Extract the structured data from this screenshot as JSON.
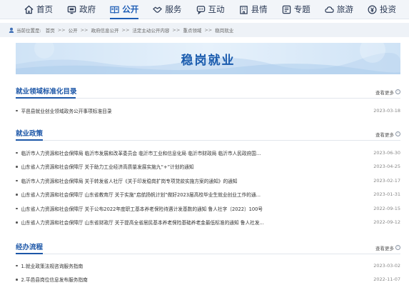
{
  "nav": {
    "items": [
      {
        "label": "首页",
        "icon": "home-icon",
        "active": false
      },
      {
        "label": "政府",
        "icon": "government-icon",
        "active": false
      },
      {
        "label": "公开",
        "icon": "book-icon",
        "active": true
      },
      {
        "label": "服务",
        "icon": "handshake-icon",
        "active": false
      },
      {
        "label": "互动",
        "icon": "chat-icon",
        "active": false
      },
      {
        "label": "县情",
        "icon": "building-icon",
        "active": false
      },
      {
        "label": "专题",
        "icon": "topic-icon",
        "active": false
      },
      {
        "label": "旅游",
        "icon": "cloud-icon",
        "active": false
      },
      {
        "label": "投资",
        "icon": "yuan-icon",
        "active": false
      }
    ],
    "accent_color": "#1c5cb5"
  },
  "breadcrumb": {
    "prefix": "当前位置是:",
    "separator": ">>",
    "items": [
      "首页",
      "公开",
      "政府信息公开",
      "法定主动公开内容",
      "重点领域",
      "稳岗就业"
    ]
  },
  "banner": {
    "title": "稳岗就业"
  },
  "sections": [
    {
      "title": "就业领域标准化目录",
      "more_label": "查看更多",
      "items": [
        {
          "text": "平邑县就业创业领域政务公开事项标准目录",
          "date": "2023-03-18"
        }
      ]
    },
    {
      "title": "就业政策",
      "more_label": "查看更多",
      "items": [
        {
          "text": "临沂市人力资源和社会保障局 临沂市发展和改革委员会 临沂市工业和信息化局 临沂市财政局 临沂市人民政府国...",
          "date": "2023-06-30"
        },
        {
          "text": "山东省人力资源和社会保障厅 关于助力工业经济高质量发展实施九“+”计划的通知",
          "date": "2023-04-25"
        },
        {
          "text": "临沂市人力资源和社会保障局 关于转发省人社厅《关于印发稳岗扩岗专项贷款实施方案的通知》的通知",
          "date": "2023-02-17"
        },
        {
          "text": "山东省人力资源和社会保障厅 山东省教育厅 关于实施“启航扬帆计划”做好2023届高校毕业生就业创业工作的通...",
          "date": "2023-01-31"
        },
        {
          "text": "山东省人力资源和社会保障厅 关于公布2022年度职工基本养老保险待遇计发基数的通知 鲁人社字〔2022〕100号",
          "date": "2022-09-15"
        },
        {
          "text": "山东省人力资源和社会保障厅 山东省财政厅 关于提高全省居民基本养老保险基础养老金最低标准的通知 鲁人社发...",
          "date": "2022-09-12"
        }
      ]
    },
    {
      "title": "经办流程",
      "more_label": "查看更多",
      "items": [
        {
          "text": "1.就业政策法规咨询服务指南",
          "date": "2023-03-02"
        },
        {
          "text": "2.平邑县岗位信息发布服务指南",
          "date": "2022-11-07"
        }
      ]
    }
  ]
}
